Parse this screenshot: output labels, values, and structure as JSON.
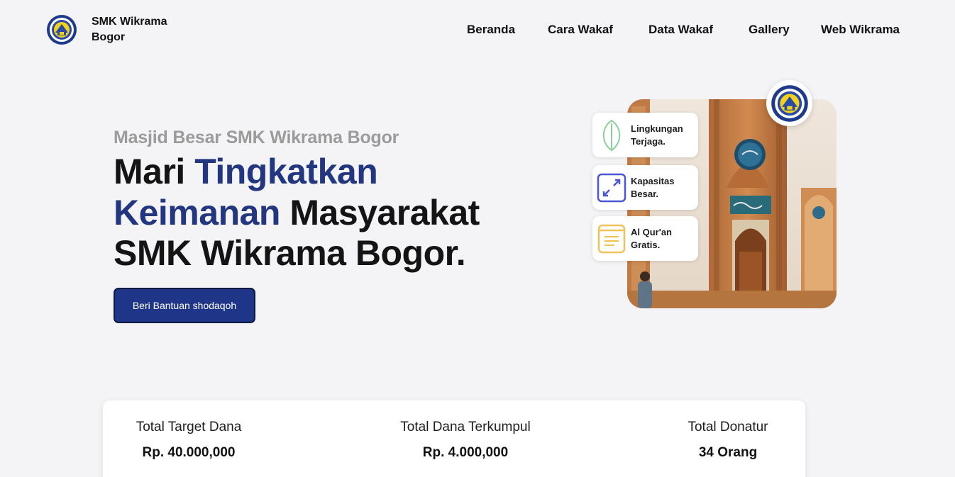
{
  "brand": {
    "name": "SMK Wikrama Bogor"
  },
  "nav": {
    "items": [
      {
        "label": "Beranda"
      },
      {
        "label": "Cara Wakaf"
      },
      {
        "label": "Data Wakaf"
      },
      {
        "label": "Gallery"
      },
      {
        "label": "Web Wikrama"
      }
    ]
  },
  "hero": {
    "eyebrow": "Masjid Besar SMK Wikrama Bogor",
    "headline": {
      "part1": "Mari ",
      "accent1": "Tingkatkan",
      "accent2": "Keimanan",
      "part2": " Masyarakat",
      "part3": "SMK Wikrama Bogor."
    },
    "cta_label": "Beri Bantuan shodaqoh"
  },
  "features": [
    {
      "label": "Lingkungan Terjaga.",
      "icon": "leaf-icon"
    },
    {
      "label": "Kapasitas Besar.",
      "icon": "expand-icon"
    },
    {
      "label": "Al Qur'an Gratis.",
      "icon": "book-icon"
    }
  ],
  "stats": [
    {
      "label": "Total Target Dana",
      "value": "Rp. 40.000,000"
    },
    {
      "label": "Total Dana Terkumpul",
      "value": "Rp. 4.000,000"
    },
    {
      "label": "Total Donatur",
      "value": "34 Orang"
    }
  ],
  "colors": {
    "accent": "#22377f",
    "button": "#1f3587",
    "background": "#f4f3f5",
    "eyebrow": "#9b9b9b"
  }
}
